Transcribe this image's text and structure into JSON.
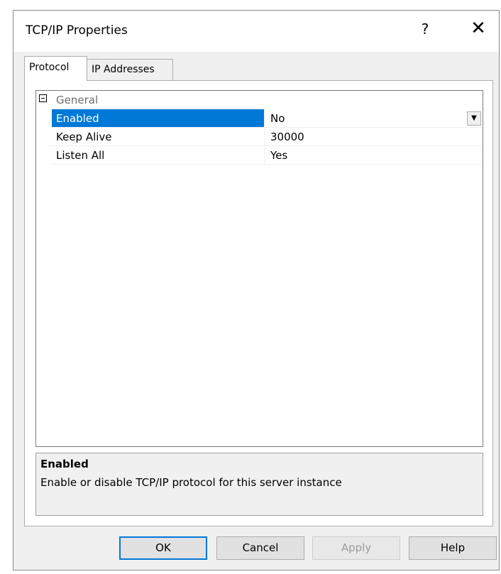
{
  "window": {
    "title": "TCP/IP Properties",
    "help_glyph": "?",
    "close_glyph": "✕"
  },
  "tabs": [
    {
      "label": "Protocol",
      "active": true
    },
    {
      "label": "IP Addresses",
      "active": false
    }
  ],
  "grid": {
    "category": {
      "label": "General",
      "expanded": true
    },
    "rows": [
      {
        "name": "Enabled",
        "value": "No",
        "selected": true
      },
      {
        "name": "Keep Alive",
        "value": "30000",
        "selected": false
      },
      {
        "name": "Listen All",
        "value": "Yes",
        "selected": false
      }
    ]
  },
  "description": {
    "title": "Enabled",
    "text": "Enable or disable TCP/IP protocol for this server instance"
  },
  "buttons": {
    "ok": "OK",
    "cancel": "Cancel",
    "apply": "Apply",
    "help": "Help"
  },
  "colors": {
    "selection": "#0078d7",
    "window_bg": "#f0f0f0"
  }
}
